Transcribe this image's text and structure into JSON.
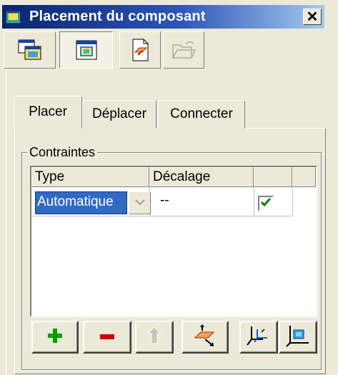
{
  "window": {
    "title": "Placement du composant",
    "close_glyph": "✕"
  },
  "toolbar": {
    "buttons": [
      {
        "name": "attach-component-icon",
        "pressed": false,
        "enabled": true
      },
      {
        "name": "component-window-icon",
        "pressed": true,
        "enabled": true
      },
      {
        "name": "placement-plane-icon",
        "pressed": false,
        "enabled": true
      },
      {
        "name": "open-folder-icon",
        "pressed": false,
        "enabled": false
      }
    ]
  },
  "tabs": [
    {
      "label": "Placer",
      "active": true
    },
    {
      "label": "Déplacer",
      "active": false
    },
    {
      "label": "Connecter",
      "active": false
    }
  ],
  "constraints": {
    "group_label": "Contraintes",
    "columns": [
      "Type",
      "Décalage",
      "",
      ""
    ],
    "rows": [
      {
        "type": "Automatique",
        "offset": "--",
        "checked": true
      }
    ]
  },
  "actions": [
    {
      "name": "add-constraint-button",
      "icon": "plus-icon",
      "enabled": true
    },
    {
      "name": "remove-constraint-button",
      "icon": "minus-icon",
      "enabled": true
    },
    {
      "name": "move-up-button",
      "icon": "arrow-up-icon",
      "enabled": false
    },
    {
      "name": "flip-constraint-button",
      "icon": "flip-plane-icon",
      "enabled": true
    },
    {
      "name": "coordinate-system-button",
      "icon": "coordinate-system-icon",
      "enabled": true
    },
    {
      "name": "default-placement-button",
      "icon": "axis-box-icon",
      "enabled": true
    }
  ],
  "colors": {
    "face": "#ece9d8",
    "title_gradient_start": "#0a246a",
    "title_gradient_end": "#a6caf0",
    "selection": "#316ac5",
    "plus_green": "#00a000",
    "minus_red": "#d40000",
    "check_green": "#008000"
  }
}
